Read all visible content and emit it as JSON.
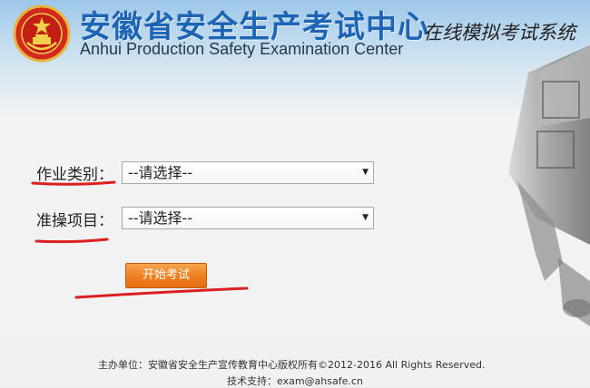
{
  "header": {
    "title_cn": "安徽省安全生产考试中心",
    "title_en": "Anhui Production Safety Examination Center",
    "system_name": "在线模拟考试系统"
  },
  "form": {
    "job_category": {
      "label": "作业类别：",
      "selected": "--请选择--"
    },
    "operation_item": {
      "label": "准操项目：",
      "selected": "--请选择--"
    },
    "start_button": "开始考试"
  },
  "footer": {
    "copyright": "主办单位：安徽省安全生产宣传教育中心版权所有©2012-2016   All Rights Reserved.",
    "support": "技术支持：exam@ahsafe.cn"
  },
  "colors": {
    "title_blue": "#1e64b4",
    "button_orange": "#ef7e1f",
    "annotation_red": "#d91f1f"
  }
}
